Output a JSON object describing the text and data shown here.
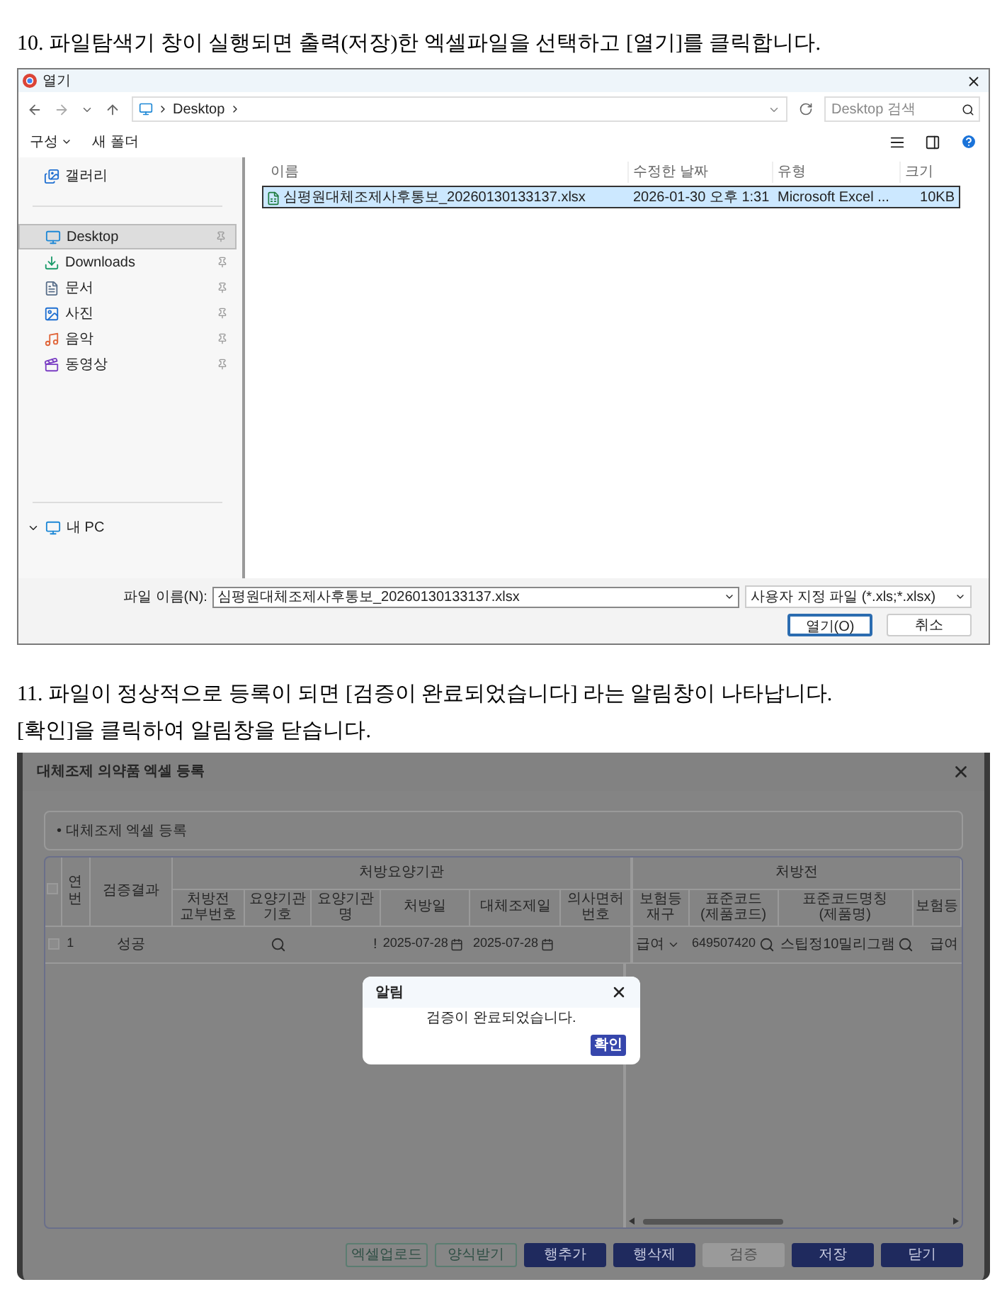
{
  "instructions": [
    {
      "lines": [
        "10. 파일탐색기 창이 실행되면 출력(저장)한 엑셀파일을 선택하고 [열기]를 클릭합니다."
      ]
    },
    {
      "lines": [
        "11. 파일이 정상적으로 등록이 되면 [검증이 완료되었습니다] 라는 알림창이 나타납니다.",
        "[확인]을 클릭하여 알림창을 닫습니다."
      ]
    }
  ],
  "open_dialog": {
    "title": "열기",
    "address": "Desktop",
    "search": {
      "placeholder": "Desktop 검색"
    },
    "commands": [
      {
        "label": "구성",
        "menu": true
      },
      {
        "label": "새 폴더",
        "menu": false
      }
    ],
    "sidebar": [
      {
        "label": "갤러리",
        "kind": "gallery",
        "selected": false,
        "pinned": false
      },
      {
        "label": "Desktop",
        "kind": "desktop",
        "selected": true,
        "pinned": true
      },
      {
        "label": "Downloads",
        "kind": "downloads",
        "selected": false,
        "pinned": true
      },
      {
        "label": "문서",
        "kind": "documents",
        "selected": false,
        "pinned": true
      },
      {
        "label": "사진",
        "kind": "pictures",
        "selected": false,
        "pinned": true
      },
      {
        "label": "음악",
        "kind": "music",
        "selected": false,
        "pinned": true
      },
      {
        "label": "동영상",
        "kind": "videos",
        "selected": false,
        "pinned": true
      }
    ],
    "this_pc": {
      "label": "내 PC",
      "expanded": true
    },
    "columns": [
      "이름",
      "수정한 날짜",
      "유형",
      "크기"
    ],
    "files": [
      {
        "name": "심평원대체조제사후통보_20260130133137.xlsx",
        "modified": "2026-01-30 오후 1:31",
        "type": "Microsoft Excel ...",
        "size": "10KB",
        "selected": true
      }
    ],
    "file_name": {
      "label": "파일 이름(N):",
      "value": "심평원대체조제사후통보_20260130133137.xlsx"
    },
    "file_type": "사용자 지정 파일 (*.xls;*.xlsx)",
    "buttons": [
      {
        "label": "열기(O)",
        "primary": true
      },
      {
        "label": "취소",
        "primary": false
      }
    ]
  },
  "excel_dialog": {
    "title": "대체조제 의약품 엑셀 등록",
    "section": "• 대체조제 엑셀 등록",
    "select_all": {
      "checked": false
    },
    "columns": [
      "연번",
      "검증결과"
    ],
    "groups": [
      {
        "label": "처방요양기관",
        "columns": [
          "처방전 교부번호",
          "요양기관기호",
          "요양기관명",
          "처방일",
          "대체조제일",
          "의사면허번호"
        ]
      },
      {
        "label": "처방전",
        "columns": [
          "보험등재구",
          "표준코드 (제품코드)",
          "표준코드명칭 (제품명)",
          "보험등"
        ]
      }
    ],
    "rows": [
      {
        "checked": false,
        "cells": [
          "1",
          "성공",
          null,
          null,
          "!",
          "2025-07-28",
          "2025-07-28",
          null,
          "급여",
          "649507420",
          "스팁정10밀리그램",
          "급여"
        ]
      }
    ],
    "buttons": [
      {
        "label": "엑셀업로드",
        "kind": "outline"
      },
      {
        "label": "양식받기",
        "kind": "outline"
      },
      {
        "label": "행추가",
        "kind": "primary"
      },
      {
        "label": "행삭제",
        "kind": "primary"
      },
      {
        "label": "검증",
        "kind": "disabled"
      },
      {
        "label": "저장",
        "kind": "primary"
      },
      {
        "label": "닫기",
        "kind": "primary"
      }
    ],
    "alert": {
      "title": "알림",
      "message": "검증이 완료되었습니다.",
      "button": "확인"
    }
  }
}
